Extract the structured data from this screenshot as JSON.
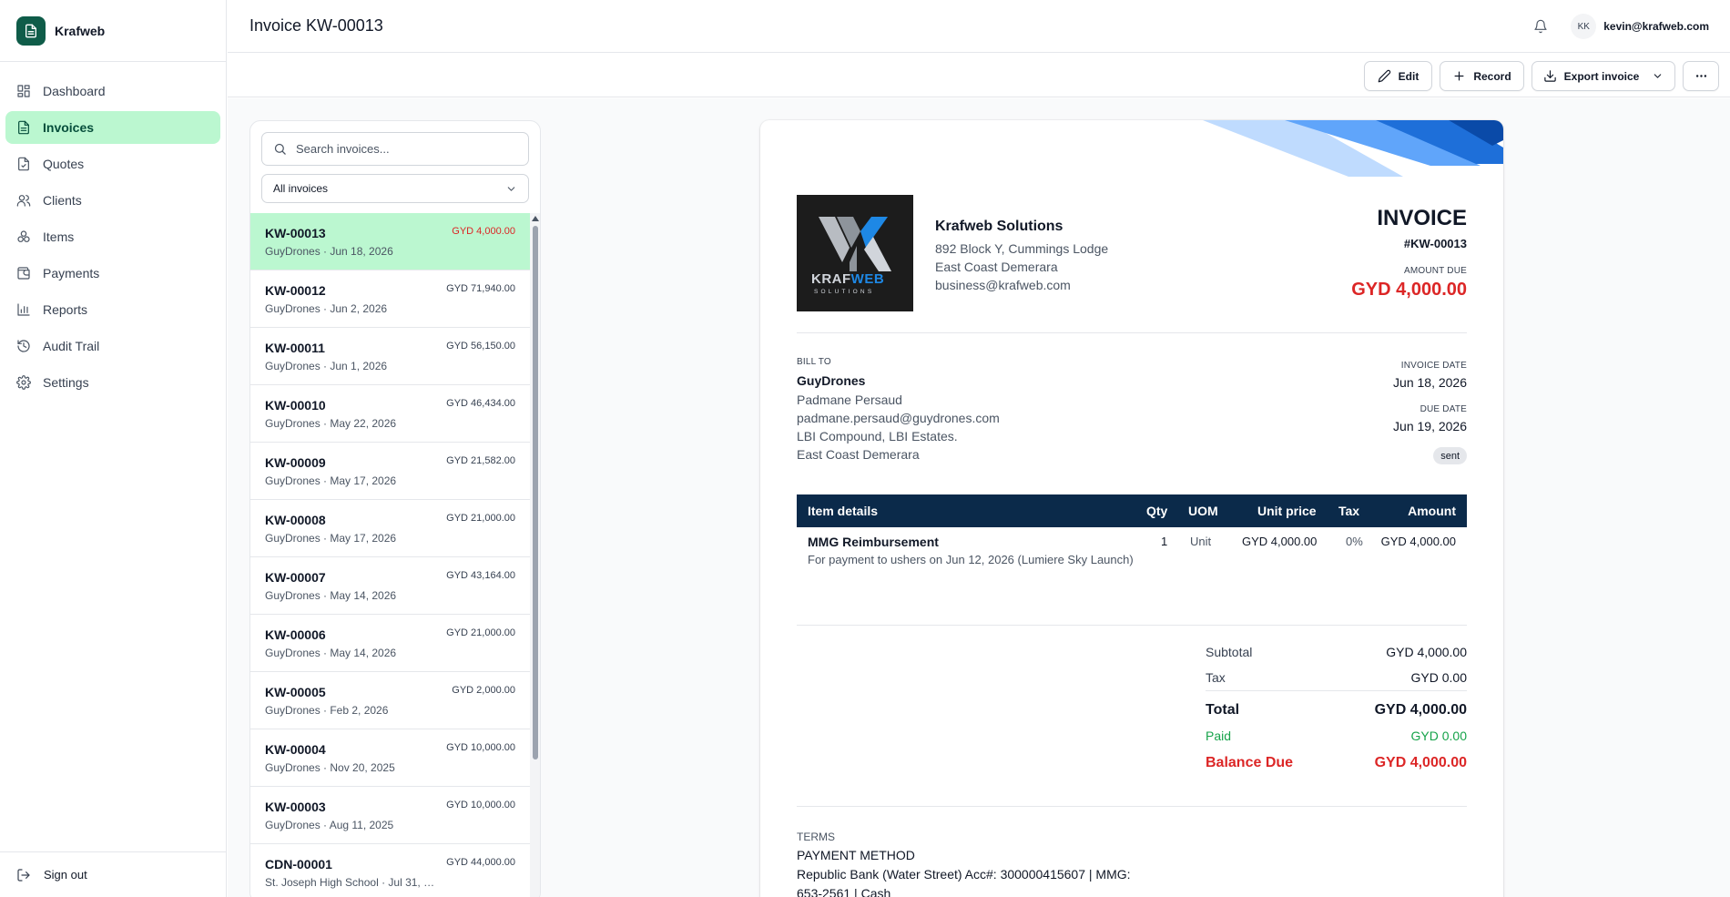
{
  "brand": {
    "name": "Krafweb"
  },
  "sidebar": {
    "items": [
      {
        "label": "Dashboard",
        "icon": "dashboard-icon"
      },
      {
        "label": "Invoices",
        "icon": "invoice-icon",
        "active": true
      },
      {
        "label": "Quotes",
        "icon": "quote-icon"
      },
      {
        "label": "Clients",
        "icon": "users-icon"
      },
      {
        "label": "Items",
        "icon": "items-icon"
      },
      {
        "label": "Payments",
        "icon": "wallet-icon"
      },
      {
        "label": "Reports",
        "icon": "bar-chart-icon"
      },
      {
        "label": "Audit Trail",
        "icon": "history-icon"
      },
      {
        "label": "Settings",
        "icon": "gear-icon"
      }
    ],
    "signout": "Sign out"
  },
  "header": {
    "title": "Invoice KW-00013",
    "avatar_initials": "KK",
    "user_email": "kevin@krafweb.com"
  },
  "toolbar": {
    "edit": "Edit",
    "record": "Record",
    "export": "Export invoice"
  },
  "list": {
    "search_placeholder": "Search invoices...",
    "filter": "All invoices",
    "rows": [
      {
        "number": "KW-00013",
        "amount": "GYD 4,000.00",
        "sub": "GuyDrones · Jun 18, 2026",
        "selected": true
      },
      {
        "number": "KW-00012",
        "amount": "GYD 71,940.00",
        "sub": "GuyDrones · Jun 2, 2026"
      },
      {
        "number": "KW-00011",
        "amount": "GYD 56,150.00",
        "sub": "GuyDrones · Jun 1, 2026"
      },
      {
        "number": "KW-00010",
        "amount": "GYD 46,434.00",
        "sub": "GuyDrones · May 22, 2026"
      },
      {
        "number": "KW-00009",
        "amount": "GYD 21,582.00",
        "sub": "GuyDrones · May 17, 2026"
      },
      {
        "number": "KW-00008",
        "amount": "GYD 21,000.00",
        "sub": "GuyDrones · May 17, 2026"
      },
      {
        "number": "KW-00007",
        "amount": "GYD 43,164.00",
        "sub": "GuyDrones · May 14, 2026"
      },
      {
        "number": "KW-00006",
        "amount": "GYD 21,000.00",
        "sub": "GuyDrones · May 14, 2026"
      },
      {
        "number": "KW-00005",
        "amount": "GYD 2,000.00",
        "sub": "GuyDrones · Feb 2, 2026"
      },
      {
        "number": "KW-00004",
        "amount": "GYD 10,000.00",
        "sub": "GuyDrones · Nov 20, 2025"
      },
      {
        "number": "KW-00003",
        "amount": "GYD 10,000.00",
        "sub": "GuyDrones · Aug 11, 2025"
      },
      {
        "number": "CDN-00001",
        "amount": "GYD 44,000.00",
        "sub": "St. Joseph High School · Jul 31, 2..."
      }
    ]
  },
  "invoice": {
    "logo_text": "KRAFWEB",
    "logo_sub": "SOLUTIONS",
    "company": {
      "name": "Krafweb Solutions",
      "address1": "892 Block Y, Cummings Lodge",
      "address2": "East Coast Demerara",
      "email": "business@krafweb.com"
    },
    "title": "INVOICE",
    "number": "#KW-00013",
    "amount_due_label": "AMOUNT DUE",
    "amount_due": "GYD 4,000.00",
    "bill_to": {
      "label": "BILL TO",
      "name": "GuyDrones",
      "contact": "Padmane Persaud",
      "email": "padmane.persaud@guydrones.com",
      "address1": "LBI Compound, LBI Estates.",
      "address2": "East Coast Demerara"
    },
    "invoice_date_label": "INVOICE DATE",
    "invoice_date": "Jun 18, 2026",
    "due_date_label": "DUE DATE",
    "due_date": "Jun 19, 2026",
    "status": "sent",
    "table": {
      "headers": [
        "Item details",
        "Qty",
        "UOM",
        "Unit price",
        "Tax",
        "Amount"
      ],
      "rows": [
        {
          "name": "MMG Reimbursement",
          "description": "For payment to ushers on Jun 12, 2026 (Lumiere Sky Launch)",
          "qty": "1",
          "uom": "Unit",
          "unit_price": "GYD 4,000.00",
          "tax": "0%",
          "amount": "GYD 4,000.00"
        }
      ]
    },
    "totals": {
      "subtotal_label": "Subtotal",
      "subtotal": "GYD 4,000.00",
      "tax_label": "Tax",
      "tax": "GYD 0.00",
      "total_label": "Total",
      "total": "GYD 4,000.00",
      "paid_label": "Paid",
      "paid": "GYD 0.00",
      "balance_label": "Balance Due",
      "balance": "GYD 4,000.00"
    },
    "terms": {
      "label": "TERMS",
      "line1": "PAYMENT METHOD",
      "line2": "Republic Bank (Water Street) Acc#: 300000415607 | MMG:",
      "line3": "653-2561 | Cash"
    }
  },
  "colors": {
    "accent": "#0f5c49",
    "active_bg": "#bbf7d0",
    "danger": "#dc2626",
    "success": "#16a34a",
    "table_header": "#0b2a4a"
  }
}
